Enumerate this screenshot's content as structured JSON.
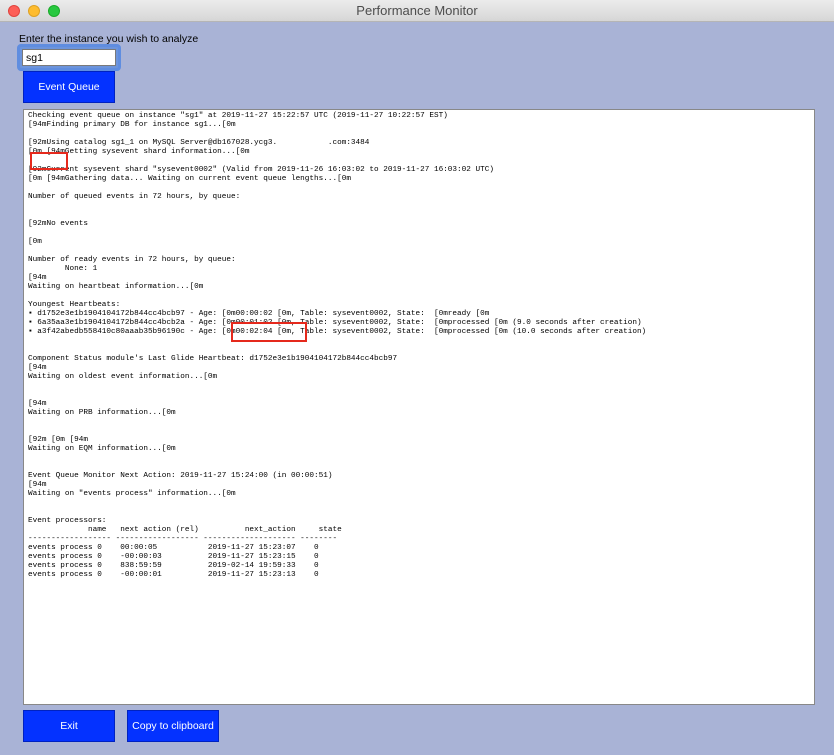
{
  "window": {
    "title": "Performance Monitor"
  },
  "prompt_label": "Enter the instance you wish to analyze",
  "instance_input": {
    "value": "sg1"
  },
  "buttons": {
    "event_queue": "Event Queue",
    "exit": "Exit",
    "copy": "Copy to clipboard"
  },
  "output_text": "Checking event queue on instance \"sg1\" at 2019-11-27 15:22:57 UTC (2019-11-27 10:22:57 EST)\n[94mFinding primary DB for instance sg1...[0m\n\n[92mUsing catalog sg1_1 on MySQL Server@db167028.ycg3.           .com:3484\n[0m [94mGetting sysevent shard information...[0m\n\n[92mCurrent sysevent shard \"sysevent0002\" (Valid from 2019-11-26 16:03:02 to 2019-11-27 16:03:02 UTC)\n[0m [94mGathering data... Waiting on current event queue lengths...[0m\n\nNumber of queued events in 72 hours, by queue:\n\n\n[92mNo events\n\n[0m\n\nNumber of ready events in 72 hours, by queue:\n        None: 1\n[94m\nWaiting on heartbeat information...[0m\n\nYoungest Heartbeats:\n▪ d1752e3e1b1904104172b844cc4bcb97 - Age: [0m00:00:02 [0m, Table: sysevent0002, State:  [0mready [0m\n▪ 6a35aa3e1b1904104172b844cc4bcb2a - Age: [0m00:01:02 [0m, Table: sysevent0002, State:  [0mprocessed [0m (9.0 seconds after creation)\n▪ a3f42abedb558410c80aaab35b96190c - Age: [0m00:02:04 [0m, Table: sysevent0002, State:  [0mprocessed [0m (10.0 seconds after creation)\n\n\nComponent Status module's Last Glide Heartbeat: d1752e3e1b1904104172b844cc4bcb97\n[94m\nWaiting on oldest event information...[0m\n\n\n[94m\nWaiting on PRB information...[0m\n\n\n[92m [0m [94m\nWaiting on EQM information...[0m\n\n\nEvent Queue Monitor Next Action: 2019-11-27 15:24:00 (in 00:00:51)\n[94m\nWaiting on \"events process\" information...[0m\n\n\nEvent processors:\n             name   next action (rel)          next_action     state\n------------------ ------------------ -------------------- --------\nevents process 0    00:00:05           2019-11-27 15:23:07    0\nevents process 0    -00:00:03          2019-11-27 15:23:15    0\nevents process 0    838:59:59          2019-02-14 19:59:33    0\nevents process 0    -00:00:01          2019-11-27 15:23:13    0",
  "colors": {
    "background": "#a9b3d6",
    "button": "#0432ff",
    "highlight": "#e5291c"
  }
}
